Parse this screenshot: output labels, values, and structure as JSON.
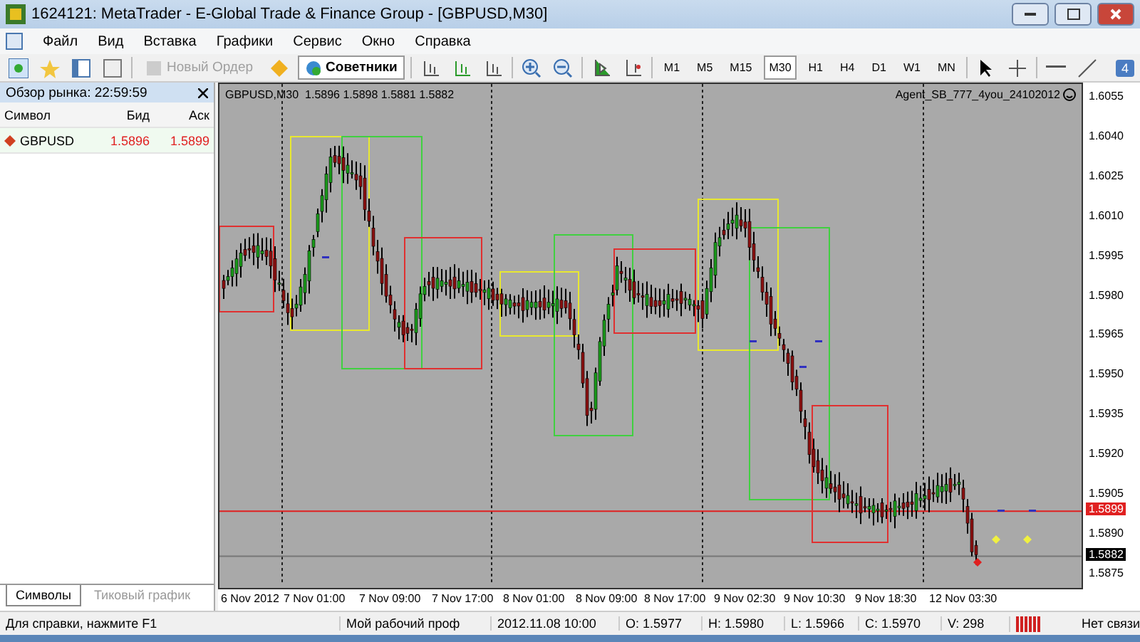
{
  "window": {
    "title": "1624121: MetaTrader - E-Global Trade & Finance Group - [GBPUSD,M30]"
  },
  "menu": [
    "Файл",
    "Вид",
    "Вставка",
    "Графики",
    "Сервис",
    "Окно",
    "Справка"
  ],
  "toolbar": {
    "new_order": {
      "label": "Новый Ордер",
      "disabled": true
    },
    "experts": {
      "label": "Советники",
      "pressed": true
    },
    "timeframes": [
      {
        "label": "M1",
        "selected": false
      },
      {
        "label": "M5",
        "selected": false
      },
      {
        "label": "M15",
        "selected": false
      },
      {
        "label": "M30",
        "selected": true
      },
      {
        "label": "H1",
        "selected": false
      },
      {
        "label": "H4",
        "selected": false
      },
      {
        "label": "D1",
        "selected": false
      },
      {
        "label": "W1",
        "selected": false
      },
      {
        "label": "MN",
        "selected": false
      }
    ],
    "badge": "4"
  },
  "market_watch": {
    "title": "Обзор рынка: 22:59:59",
    "columns": [
      "Символ",
      "Бид",
      "Аск"
    ],
    "rows": [
      {
        "symbol": "GBPUSD",
        "bid": "1.5896",
        "ask": "1.5899"
      }
    ],
    "tabs": [
      {
        "label": "Символы",
        "selected": true
      },
      {
        "label": "Тиковый график",
        "selected": false
      }
    ]
  },
  "chart": {
    "header": "GBPUSD,M30  1.5896 1.5898 1.5881 1.5882",
    "expert": "Agent_SB_777_4you_24102012",
    "price_labels": [
      "1.6055",
      "1.6040",
      "1.6025",
      "1.6010",
      "1.5995",
      "1.5980",
      "1.5965",
      "1.5950",
      "1.5935",
      "1.5920",
      "1.5905",
      "1.5890",
      "1.5875"
    ],
    "ask_label": "1.5899",
    "bid_label": "1.5882",
    "time_labels": [
      "6 Nov 2012",
      "7 Nov 01:00",
      "7 Nov 09:00",
      "7 Nov 17:00",
      "8 Nov 01:00",
      "8 Nov 09:00",
      "8 Nov 17:00",
      "9 Nov 02:30",
      "9 Nov 10:30",
      "9 Nov 18:30",
      "12 Nov 03:30"
    ]
  },
  "status_bar": {
    "help": "Для справки, нажмите F1",
    "profile": "Мой рабочий проф",
    "time": "2012.11.08 10:00",
    "open": "O: 1.5977",
    "high": "H: 1.5980",
    "low": "L: 1.5966",
    "close": "C: 1.5970",
    "volume": "V: 298",
    "connection": "Нет связи"
  }
}
